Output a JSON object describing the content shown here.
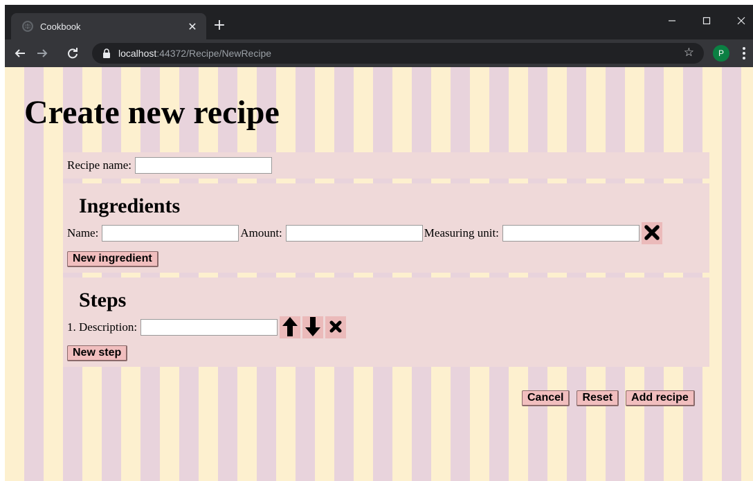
{
  "browser": {
    "tab_title": "Cookbook",
    "url_host": "localhost",
    "url_path": ":44372/Recipe/NewRecipe",
    "profile_initial": "P"
  },
  "page": {
    "title": "Create new recipe",
    "recipe_name_label": "Recipe name:",
    "recipe_name_value": "",
    "ingredients": {
      "heading": "Ingredients",
      "name_label": "Name:",
      "amount_label": "Amount:",
      "unit_label": "Measuring unit:",
      "name_value": "",
      "amount_value": "",
      "unit_value": "",
      "new_button": "New ingredient"
    },
    "steps": {
      "heading": "Steps",
      "items": [
        {
          "label": "1. Description:",
          "value": ""
        }
      ],
      "new_button": "New step"
    },
    "actions": {
      "cancel": "Cancel",
      "reset": "Reset",
      "add": "Add recipe"
    }
  },
  "colors": {
    "stripe_light": "#fdf0cf",
    "stripe_dark": "#e8d3dc",
    "section_bg": "#efd9d9",
    "button_bg": "#f1bebe",
    "profile_avatar": "#0b8043"
  },
  "icons": [
    "remove-ingredient-icon",
    "move-up-icon",
    "move-down-icon",
    "remove-step-icon"
  ]
}
